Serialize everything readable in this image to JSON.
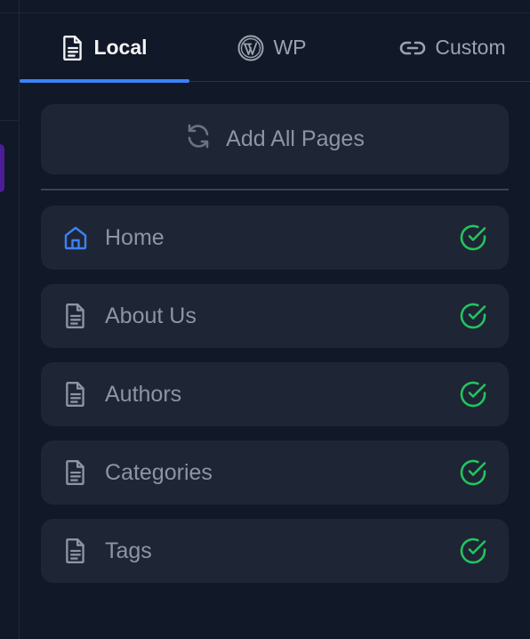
{
  "tabs": [
    {
      "label": "Local",
      "icon": "document-icon",
      "active": true
    },
    {
      "label": "WP",
      "icon": "wordpress-icon",
      "active": false
    },
    {
      "label": "Custom",
      "icon": "link-icon",
      "active": false
    }
  ],
  "add_all": {
    "label": "Add All Pages",
    "icon": "refresh-icon"
  },
  "pages": [
    {
      "label": "Home",
      "icon": "home-icon",
      "added": true
    },
    {
      "label": "About Us",
      "icon": "document-icon",
      "added": true
    },
    {
      "label": "Authors",
      "icon": "document-icon",
      "added": true
    },
    {
      "label": "Categories",
      "icon": "document-icon",
      "added": true
    },
    {
      "label": "Tags",
      "icon": "document-icon",
      "added": true
    }
  ],
  "colors": {
    "background": "#111827",
    "card": "#1e2535",
    "accent": "#3b82f6",
    "success": "#22c55e",
    "text_muted": "#8b95a5"
  }
}
